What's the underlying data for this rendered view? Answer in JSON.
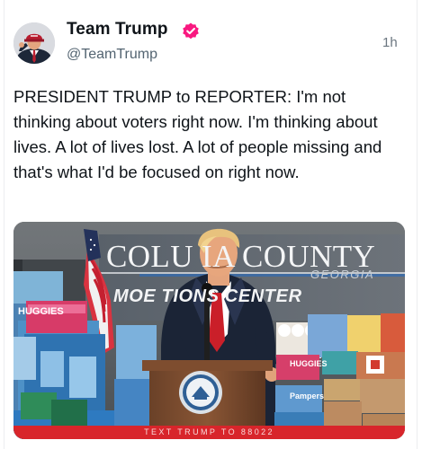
{
  "post": {
    "display_name": "Team Trump",
    "handle": "@TeamTrump",
    "timestamp": "1h",
    "verified_icon": "verified-badge-icon",
    "text": "PRESIDENT TRUMP to REPORTER: I'm not thinking about voters right now. I'm thinking about lives. A lot of lives lost. A lot of people missing and that's what I'd be focused on right now."
  },
  "media": {
    "sign_line_1": "COLU    IA COUNTY",
    "sign_line_2": "GEORGIA",
    "sign_line_3": "MOE        TIONS CENTER",
    "box_label_1": "HUGGIES",
    "box_label_2": "HUGGIES",
    "box_label_3": "Pampers",
    "banner_text": "TEXT TRUMP TO 88022"
  },
  "colors": {
    "verified": "#f91880",
    "banner": "#d8252b",
    "text": "#0f1419",
    "secondary": "#536471"
  }
}
